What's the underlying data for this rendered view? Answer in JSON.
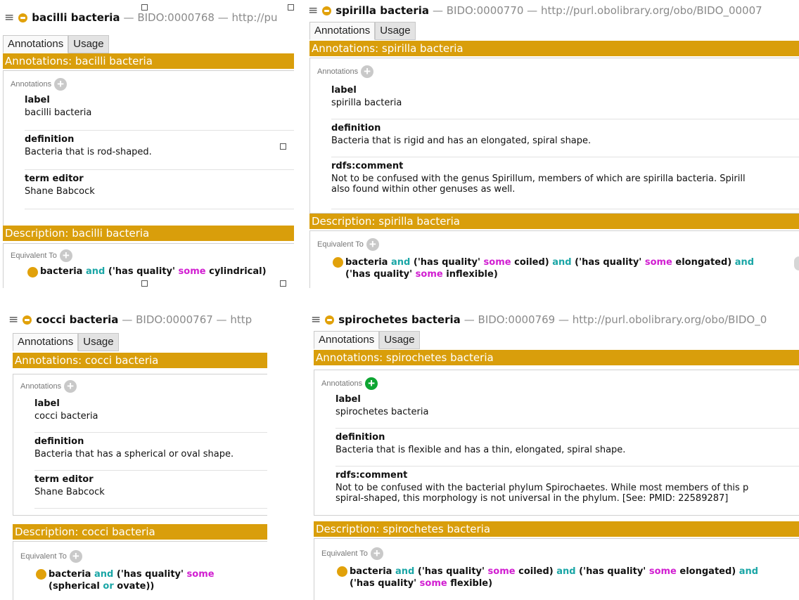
{
  "panels": {
    "bacilli": {
      "title_name": "bacilli bacteria",
      "title_rest": "— BIDO:0000768 — http://pu",
      "tabs": [
        "Annotations",
        "Usage"
      ],
      "annotations_band": "Annotations: bacilli bacteria",
      "annotations_label": "Annotations",
      "entries": [
        {
          "key": "label",
          "value": "bacilli bacteria"
        },
        {
          "key": "definition",
          "value": "Bacteria that is rod-shaped."
        },
        {
          "key": "term editor",
          "value": "Shane Babcock"
        }
      ],
      "description_band": "Description: bacilli bacteria",
      "equivalent_label": "Equivalent To",
      "expr": {
        "p1": "bacteria",
        "and1": "and",
        "p2": "('has quality'",
        "some1": "some",
        "p3": "cylindrical)"
      }
    },
    "spirilla": {
      "title_name": "spirilla bacteria",
      "title_rest": "— BIDO:0000770 — http://purl.obolibrary.org/obo/BIDO_00007",
      "tabs": [
        "Annotations",
        "Usage"
      ],
      "annotations_band": "Annotations: spirilla bacteria",
      "annotations_label": "Annotations",
      "entries": [
        {
          "key": "label",
          "value": "spirilla bacteria"
        },
        {
          "key": "definition",
          "value": "Bacteria that is rigid and has an elongated, spiral shape."
        },
        {
          "key": "rdfs:comment",
          "value": "Not to be confused with the genus Spirillum, members of which are spirilla bacteria. Spirill",
          "value2": "also found within other genuses as well."
        }
      ],
      "description_band": "Description: spirilla bacteria",
      "equivalent_label": "Equivalent To",
      "expr": {
        "p1": "bacteria",
        "and1": "and",
        "p2": "('has quality'",
        "some1": "some",
        "p3": "coiled)",
        "and2": "and",
        "p4": "('has quality'",
        "some2": "some",
        "p5": "elongated)",
        "and3": "and",
        "p6": "('has quality'",
        "some3": "some",
        "p7": "inflexible)"
      }
    },
    "cocci": {
      "title_name": "cocci bacteria",
      "title_rest": "— BIDO:0000767 — http",
      "tabs": [
        "Annotations",
        "Usage"
      ],
      "annotations_band": "Annotations: cocci bacteria",
      "annotations_label": "Annotations",
      "entries": [
        {
          "key": "label",
          "value": "cocci bacteria"
        },
        {
          "key": "definition",
          "value": "Bacteria that has a spherical or oval shape."
        },
        {
          "key": "term editor",
          "value": "Shane Babcock"
        }
      ],
      "description_band": "Description: cocci bacteria",
      "equivalent_label": "Equivalent To",
      "expr": {
        "p1": "bacteria",
        "and1": "and",
        "p2": "('has quality'",
        "some1": "some",
        "p3": "(spherical",
        "or1": "or",
        "p4": "ovate))"
      }
    },
    "spirochetes": {
      "title_name": "spirochetes bacteria",
      "title_rest": "— BIDO:0000769 — http://purl.obolibrary.org/obo/BIDO_0",
      "tabs": [
        "Annotations",
        "Usage"
      ],
      "annotations_band": "Annotations: spirochetes bacteria",
      "annotations_label": "Annotations",
      "entries": [
        {
          "key": "label",
          "value": "spirochetes bacteria"
        },
        {
          "key": "definition",
          "value": "Bacteria that is flexible and has a thin, elongated, spiral shape."
        },
        {
          "key": "rdfs:comment",
          "value": "Not to be confused with the bacterial phylum Spirochaetes. While most members of this p",
          "value2": "spiral-shaped, this morphology is not universal in the phylum. [See: PMID: 22589287]"
        }
      ],
      "description_band": "Description: spirochetes bacteria",
      "equivalent_label": "Equivalent To",
      "expr": {
        "p1": "bacteria",
        "and1": "and",
        "p2": "('has quality'",
        "some1": "some",
        "p3": "coiled)",
        "and2": "and",
        "p4": "('has quality'",
        "some2": "some",
        "p5": "elongated)",
        "and3": "and",
        "p6": "('has quality'",
        "some3": "some",
        "p7": "flexible)"
      }
    }
  },
  "icons": {
    "menu": "hamburger-icon",
    "class": "class-icon",
    "add": "add-icon"
  },
  "colors": {
    "band": "#d99e0b",
    "keyword_and": "#1aa6a6",
    "keyword_some": "#d11ed1",
    "add_active": "#0ea532"
  },
  "glyphs": {
    "menu": "≡",
    "plus": "+"
  }
}
